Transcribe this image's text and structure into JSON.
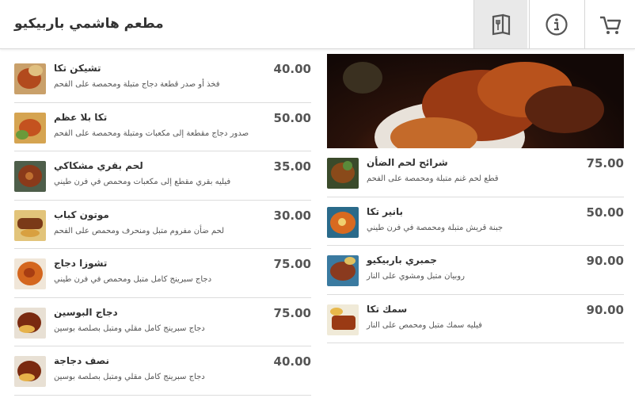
{
  "header": {
    "title": "مطعم هاشمي باربيكيو",
    "buttons": [
      {
        "icon": "menu-book-icon",
        "active": true
      },
      {
        "icon": "info-icon",
        "active": false
      },
      {
        "icon": "cart-icon",
        "active": false
      }
    ]
  },
  "left_items": [
    {
      "name": "تشيكن تكا",
      "desc": "فخذ أو صدر قطعة دجاج متبلة ومحمصة على الفحم",
      "price": "40.00"
    },
    {
      "name": "تكا بلا عظم",
      "desc": "صدور دجاج مقطعة إلى مكعبات ومتبلة ومحمصة على الفحم",
      "price": "50.00"
    },
    {
      "name": "لحم بقري مشكاكي",
      "desc": "فيليه بقري مقطع إلى مكعبات ومحمص في فرن طيني",
      "price": "35.00"
    },
    {
      "name": "موتون كباب",
      "desc": "لحم ضأن مفروم متبل ومنحرف ومحمص على الفحم",
      "price": "30.00"
    },
    {
      "name": "تشوزا دجاج",
      "desc": "دجاج سبرينج كامل متبل ومحمص في فرن طيني",
      "price": "75.00"
    },
    {
      "name": "دجاج البوسين",
      "desc": "دجاج سبرينج كامل مقلي ومتبل بصلصة بوسين",
      "price": "75.00"
    },
    {
      "name": "نصف دجاجة",
      "desc": "دجاج سبرينج كامل مقلي ومتبل بصلصة بوسين",
      "price": "40.00"
    }
  ],
  "right_items": [
    {
      "name": "شرائح لحم الضأن",
      "desc": "قطع لحم غنم متبلة ومحمصة على الفحم",
      "price": "75.00"
    },
    {
      "name": "بانير تكا",
      "desc": "جبنة قريش متبلة ومحمصة في فرن طيني",
      "price": "50.00"
    },
    {
      "name": "جمبري باربيكيو",
      "desc": "روبيان متبل ومشوي على النار",
      "price": "90.00"
    },
    {
      "name": "سمك تكا",
      "desc": "فيليه سمك متبل ومحمص على النار",
      "price": "90.00"
    }
  ],
  "colors": {
    "header_active_bg": "#e9e9e9",
    "divider": "#dcdcdc",
    "text": "#333333"
  }
}
